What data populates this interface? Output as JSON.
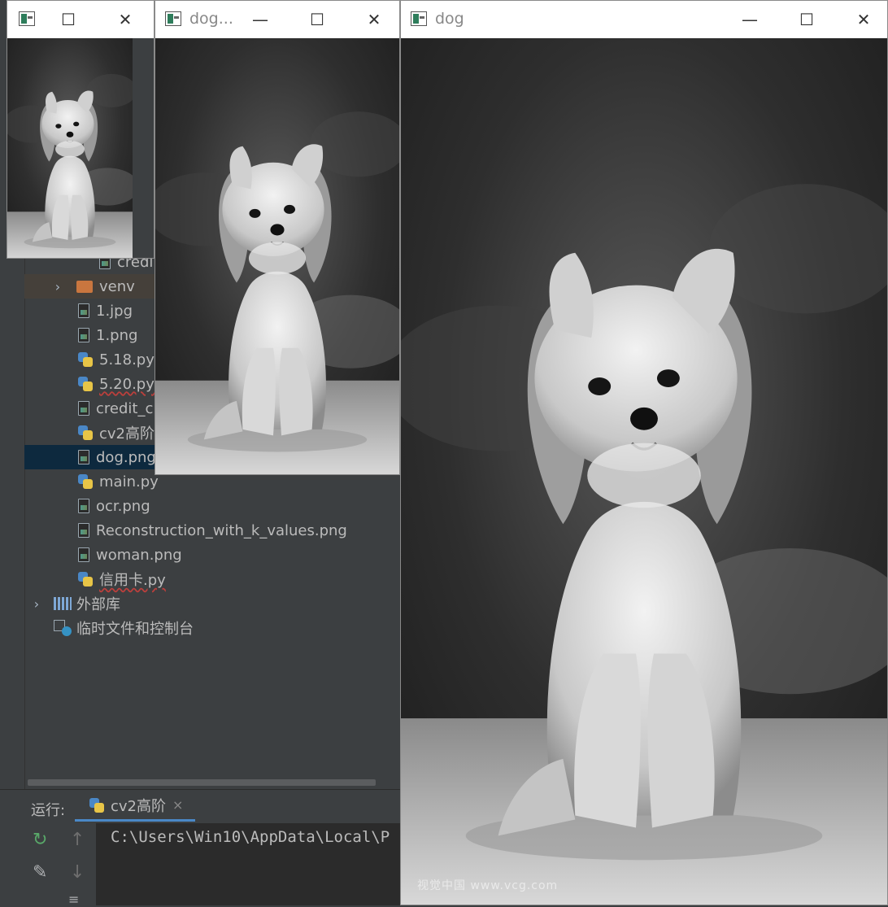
{
  "ide": {
    "tree_items": [
      {
        "label": "credi",
        "type": "image"
      },
      {
        "label": "venv",
        "type": "folder"
      },
      {
        "label": "1.jpg",
        "type": "image"
      },
      {
        "label": "1.png",
        "type": "image"
      },
      {
        "label": "5.18.py",
        "type": "python"
      },
      {
        "label": "5.20.py",
        "type": "python"
      },
      {
        "label": "credit_c",
        "type": "image"
      },
      {
        "label": "cv2高阶.",
        "type": "python"
      },
      {
        "label": "dog.png",
        "type": "image"
      },
      {
        "label": "main.py",
        "type": "python"
      },
      {
        "label": "ocr.png",
        "type": "image"
      },
      {
        "label": "Reconstruction_with_k_values.png",
        "type": "image"
      },
      {
        "label": "woman.png",
        "type": "image"
      },
      {
        "label": "信用卡.py",
        "type": "python"
      },
      {
        "label": "外部库",
        "type": "library"
      },
      {
        "label": "临时文件和控制台",
        "type": "scratch"
      }
    ],
    "run_panel": {
      "label": "运行:",
      "tab_label": "cv2高阶",
      "tab_close": "×",
      "console_line": "C:\\Users\\Win10\\AppData\\Local\\P"
    }
  },
  "windows": {
    "small": {
      "title": ""
    },
    "medium": {
      "title": "dog..."
    },
    "large": {
      "title": "dog",
      "watermark": "视觉中国 www.vcg.com"
    }
  },
  "window_controls": {
    "minimize": "—",
    "maximize": "☐",
    "close": "✕"
  },
  "colors": {
    "ide_bg": "#3c3f41",
    "selection": "#0d293e",
    "run_tab_accent": "#4a88c7",
    "folder": "#c9763f"
  }
}
